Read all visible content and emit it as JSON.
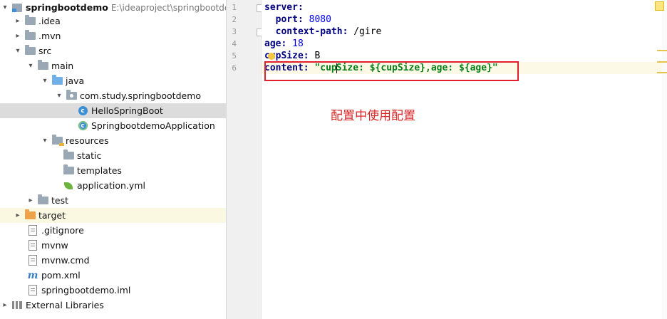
{
  "project_tree": {
    "root": {
      "label": "springbootdemo",
      "path": "E:\\ideaproject\\springbootdemo"
    },
    "items": [
      {
        "label": ".idea"
      },
      {
        "label": ".mvn"
      },
      {
        "label": "src"
      },
      {
        "label": "main"
      },
      {
        "label": "java"
      },
      {
        "label": "com.study.springbootdemo"
      },
      {
        "label": "HelloSpringBoot"
      },
      {
        "label": "SpringbootdemoApplication"
      },
      {
        "label": "resources"
      },
      {
        "label": "static"
      },
      {
        "label": "templates"
      },
      {
        "label": "application.yml"
      },
      {
        "label": "test"
      },
      {
        "label": "target"
      },
      {
        "label": ".gitignore"
      },
      {
        "label": "mvnw"
      },
      {
        "label": "mvnw.cmd"
      },
      {
        "label": "pom.xml"
      },
      {
        "label": "springbootdemo.iml"
      },
      {
        "label": "External Libraries"
      }
    ],
    "icons": {
      "class": "c-class-icon",
      "maven": "m"
    }
  },
  "editor": {
    "line_numbers": [
      "1",
      "2",
      "3",
      "4",
      "5",
      "6"
    ],
    "lines": [
      {
        "key": "server:",
        "value": ""
      },
      {
        "key": "  port:",
        "value": " 8080"
      },
      {
        "key": "  context-path:",
        "value": " /gire"
      },
      {
        "key": "age:",
        "value": " 18"
      },
      {
        "key": "cupSize:",
        "value": " B"
      },
      {
        "key": "content:",
        "value_pre": " \"cup",
        "value_post": "Size: ${cupSize},age: ${age}\""
      }
    ]
  },
  "annotation": {
    "text": "配置中使用配置",
    "color": "#d92525"
  },
  "colors": {
    "selection": "#dcdcdc",
    "highlight_box": "#e0202a",
    "key": "#000080",
    "string": "#067d17",
    "number": "#0000ff"
  }
}
